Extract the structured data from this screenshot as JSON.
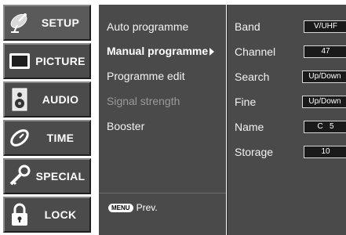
{
  "categories": [
    {
      "label": "SETUP",
      "icon": "satellite-dish-icon"
    },
    {
      "label": "PICTURE",
      "icon": "tv-screen-icon"
    },
    {
      "label": "AUDIO",
      "icon": "speaker-icon"
    },
    {
      "label": "TIME",
      "icon": "clock-icon"
    },
    {
      "label": "SPECIAL",
      "icon": "key-icon"
    },
    {
      "label": "LOCK",
      "icon": "padlock-icon"
    }
  ],
  "menu": {
    "items": [
      {
        "label": "Auto programme"
      },
      {
        "label": "Manual programme"
      },
      {
        "label": "Programme edit"
      },
      {
        "label": "Signal strength"
      },
      {
        "label": "Booster"
      }
    ],
    "footer": {
      "button": "MENU",
      "text": "Prev."
    }
  },
  "settings": {
    "rows": [
      {
        "label": "Band",
        "value": "V/UHF"
      },
      {
        "label": "Channel",
        "value": "47"
      },
      {
        "label": "Search",
        "value": "Up/Down"
      },
      {
        "label": "Fine",
        "value": "Up/Down"
      },
      {
        "label": "Name",
        "value": "C   5"
      },
      {
        "label": "Storage",
        "value": "10"
      }
    ]
  }
}
